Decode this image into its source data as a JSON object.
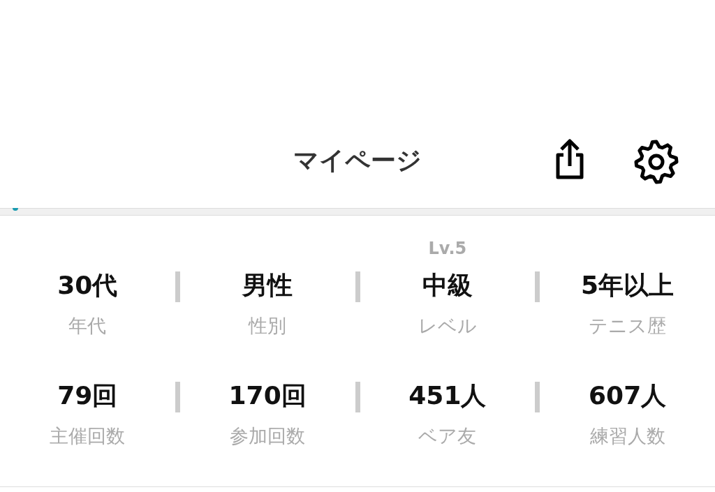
{
  "header": {
    "title": "マイページ"
  },
  "stats": [
    [
      {
        "value": "30代",
        "label": "年代"
      },
      {
        "value": "男性",
        "label": "性別"
      },
      {
        "value": "中級",
        "label": "レベル",
        "sublabel": "Lv.5"
      },
      {
        "value": "5年以上",
        "label": "テニス歴"
      }
    ],
    [
      {
        "value": "79回",
        "label": "主催回数"
      },
      {
        "value": "170回",
        "label": "参加回数"
      },
      {
        "value": "451人",
        "label": "ベア友"
      },
      {
        "value": "607人",
        "label": "練習人数"
      }
    ]
  ]
}
